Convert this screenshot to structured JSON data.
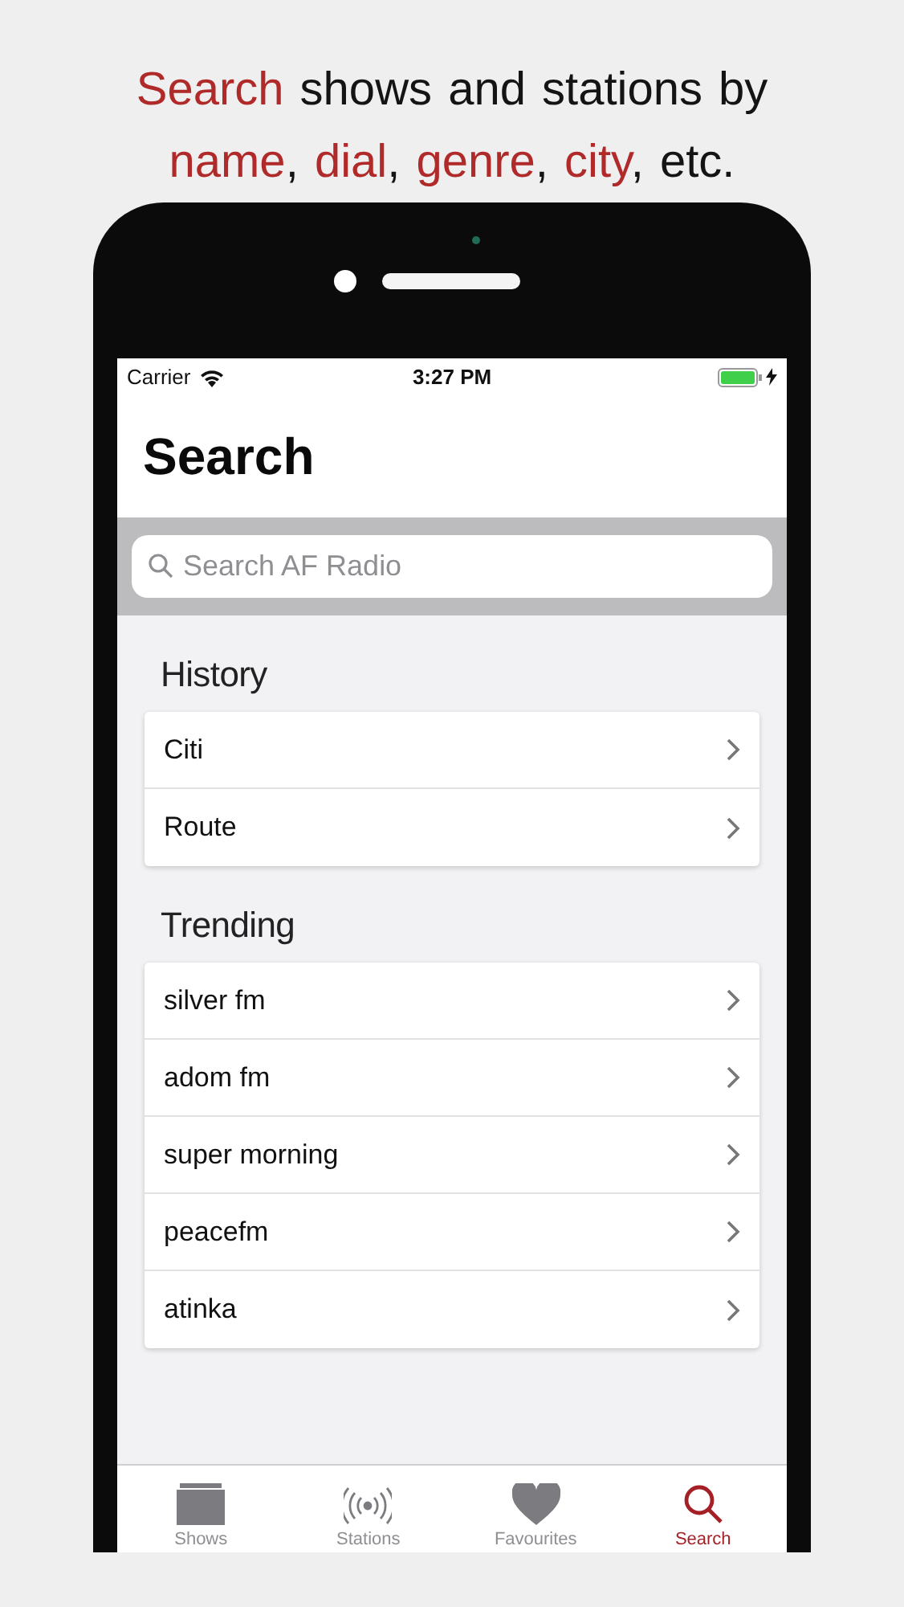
{
  "headline": [
    {
      "text": "Search",
      "highlight": true
    },
    {
      "text": " shows and stations by ",
      "highlight": false
    },
    {
      "text": "name",
      "highlight": true
    },
    {
      "text": ", ",
      "highlight": false
    },
    {
      "text": "dial",
      "highlight": true
    },
    {
      "text": ", ",
      "highlight": false
    },
    {
      "text": "genre",
      "highlight": true
    },
    {
      "text": ", ",
      "highlight": false
    },
    {
      "text": "city",
      "highlight": true
    },
    {
      "text": ", etc.",
      "highlight": false
    }
  ],
  "status_bar": {
    "carrier": "Carrier",
    "time": "3:27 PM",
    "battery_charging": true
  },
  "title": "Search",
  "search": {
    "placeholder": "Search AF Radio"
  },
  "sections": [
    {
      "title": "History",
      "items": [
        "Citi",
        "Route"
      ]
    },
    {
      "title": "Trending",
      "items": [
        "silver fm",
        "adom fm",
        "super morning",
        "peacefm",
        "atinka"
      ]
    }
  ],
  "tabs": [
    {
      "label": "Shows",
      "kind": "shows",
      "selected": false
    },
    {
      "label": "Stations",
      "kind": "stations",
      "selected": false
    },
    {
      "label": "Favourites",
      "kind": "favourites",
      "selected": false
    },
    {
      "label": "Search",
      "kind": "search",
      "selected": true
    }
  ]
}
